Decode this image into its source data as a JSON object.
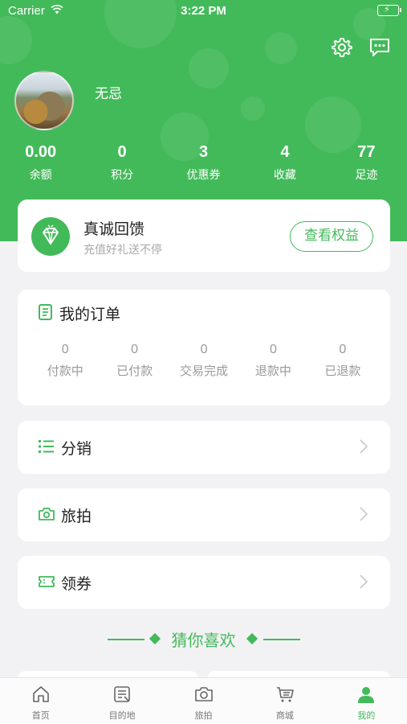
{
  "status_bar": {
    "carrier": "Carrier",
    "time": "3:22 PM"
  },
  "profile": {
    "username": "无忌"
  },
  "stats": [
    {
      "value": "0.00",
      "label": "余额"
    },
    {
      "value": "0",
      "label": "积分"
    },
    {
      "value": "3",
      "label": "优惠券"
    },
    {
      "value": "4",
      "label": "收藏"
    },
    {
      "value": "77",
      "label": "足迹"
    }
  ],
  "feedback": {
    "title": "真诚回馈",
    "subtitle": "充值好礼送不停",
    "button": "查看权益"
  },
  "orders": {
    "title": "我的订单",
    "items": [
      {
        "count": "0",
        "label": "付款中"
      },
      {
        "count": "0",
        "label": "已付款"
      },
      {
        "count": "0",
        "label": "交易完成"
      },
      {
        "count": "0",
        "label": "退款中"
      },
      {
        "count": "0",
        "label": "已退款"
      }
    ]
  },
  "menu": [
    {
      "label": "分销",
      "icon": "list-icon"
    },
    {
      "label": "旅拍",
      "icon": "camera-icon"
    },
    {
      "label": "领券",
      "icon": "ticket-icon"
    }
  ],
  "recommend": {
    "title": "猜你喜欢"
  },
  "tabbar": [
    {
      "label": "首页",
      "icon": "home-icon"
    },
    {
      "label": "目的地",
      "icon": "destination-icon"
    },
    {
      "label": "旅拍",
      "icon": "camera-icon"
    },
    {
      "label": "商城",
      "icon": "cart-icon"
    },
    {
      "label": "我的",
      "icon": "user-icon",
      "active": true
    }
  ],
  "colors": {
    "accent": "#43ba5a",
    "background": "#f2f2f4"
  }
}
